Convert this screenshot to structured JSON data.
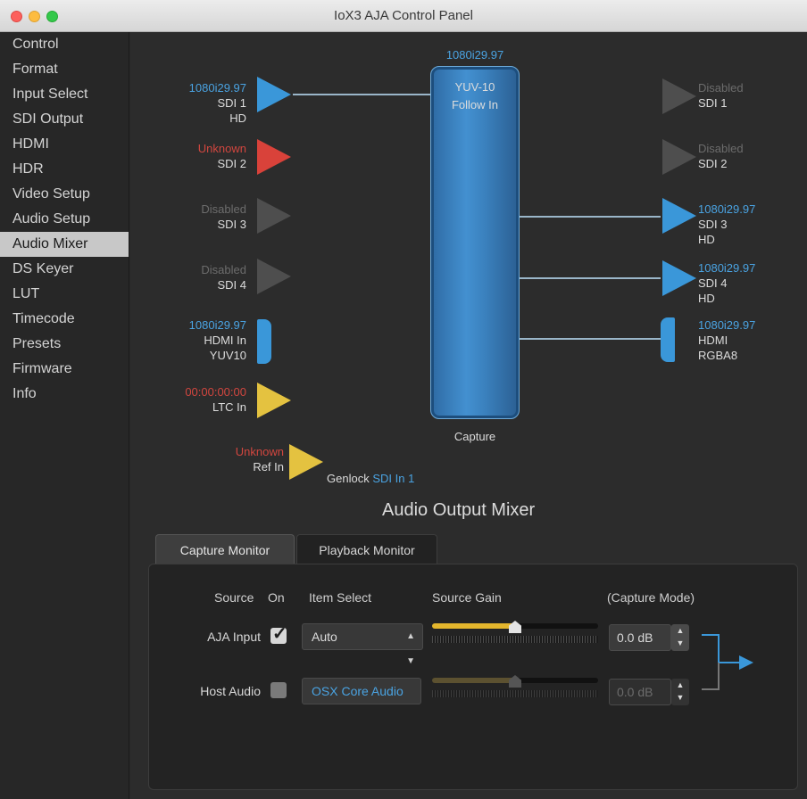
{
  "window": {
    "title": "IoX3 AJA Control Panel"
  },
  "sidebar": {
    "items": [
      {
        "label": "Control"
      },
      {
        "label": "Format"
      },
      {
        "label": "Input Select"
      },
      {
        "label": "SDI Output"
      },
      {
        "label": "HDMI"
      },
      {
        "label": "HDR"
      },
      {
        "label": "Video Setup"
      },
      {
        "label": "Audio Setup"
      },
      {
        "label": "Audio Mixer"
      },
      {
        "label": "DS Keyer"
      },
      {
        "label": "LUT"
      },
      {
        "label": "Timecode"
      },
      {
        "label": "Presets"
      },
      {
        "label": "Firmware"
      },
      {
        "label": "Info"
      }
    ],
    "selected": "Audio Mixer"
  },
  "inputs": {
    "sdi1": {
      "format": "1080i29.97",
      "name": "SDI 1",
      "detail": "HD"
    },
    "sdi2": {
      "format": "Unknown",
      "name": "SDI 2"
    },
    "sdi3": {
      "format": "Disabled",
      "name": "SDI 3"
    },
    "sdi4": {
      "format": "Disabled",
      "name": "SDI 4"
    },
    "hdmi": {
      "format": "1080i29.97",
      "name": "HDMI In",
      "detail": "YUV10"
    },
    "ltc": {
      "format": "00:00:00:00",
      "name": "LTC In"
    },
    "ref": {
      "format": "Unknown",
      "name": "Ref In"
    }
  },
  "center": {
    "top_format": "1080i29.97",
    "line1": "YUV-10",
    "line2": "Follow In",
    "bottom": "Capture"
  },
  "genlock": {
    "label": "Genlock",
    "value": "SDI In 1"
  },
  "outputs": {
    "sdi1": {
      "format": "Disabled",
      "name": "SDI 1"
    },
    "sdi2": {
      "format": "Disabled",
      "name": "SDI 2"
    },
    "sdi3": {
      "format": "1080i29.97",
      "name": "SDI 3",
      "detail": "HD"
    },
    "sdi4": {
      "format": "1080i29.97",
      "name": "SDI 4",
      "detail": "HD"
    },
    "hdmi": {
      "format": "1080i29.97",
      "name": "HDMI",
      "detail": "RGBA8"
    }
  },
  "mixer": {
    "title": "Audio Output Mixer",
    "tabs": [
      {
        "label": "Capture Monitor",
        "active": true
      },
      {
        "label": "Playback Monitor",
        "active": false
      }
    ],
    "headers": {
      "source": "Source",
      "on": "On",
      "item_select": "Item Select",
      "source_gain": "Source Gain",
      "mode": "(Capture Mode)"
    },
    "rows": [
      {
        "source": "AJA Input",
        "on": true,
        "item": "Auto",
        "gain_fraction": 0.5,
        "gain": "0.0 dB"
      },
      {
        "source": "Host Audio",
        "on": false,
        "item": "OSX Core Audio",
        "gain_fraction": 0.5,
        "gain": "0.0 dB"
      }
    ]
  },
  "colors": {
    "accent": "#3a97d9",
    "warning": "#d1463f",
    "disabled": "#6c6c6c",
    "timecode": "#e4c240"
  }
}
